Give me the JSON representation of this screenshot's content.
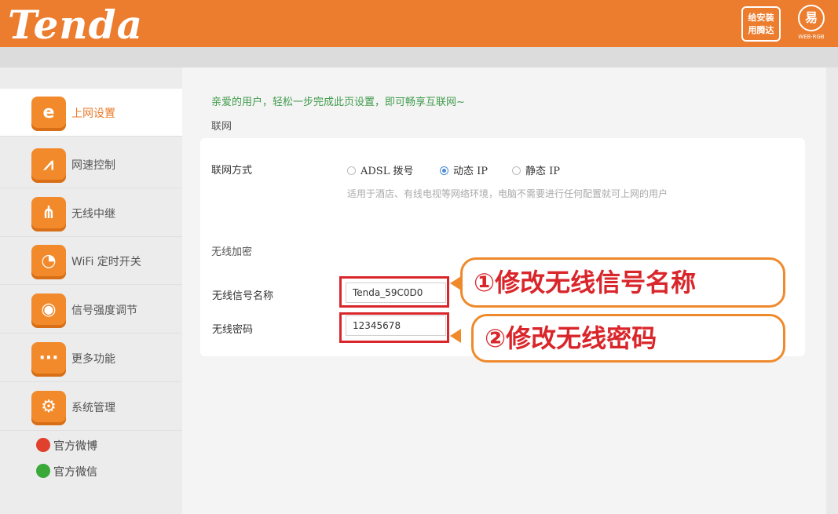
{
  "header": {
    "logo": "Tenda",
    "app_badge_line1": "给安装",
    "app_badge_line2": "用腾达",
    "brand_mark": "易",
    "brand_small": "WEB·RGB"
  },
  "sidebar": {
    "items": [
      {
        "label": "上网设置",
        "icon": "ie-icon",
        "glyph": "e"
      },
      {
        "label": "网速控制",
        "icon": "speed-icon",
        "glyph": "⩘"
      },
      {
        "label": "无线中继",
        "icon": "repeater-icon",
        "glyph": "⋔"
      },
      {
        "label": "WiFi 定时开关",
        "icon": "timer-icon",
        "glyph": "◔"
      },
      {
        "label": "信号强度调节",
        "icon": "signal-icon",
        "glyph": "◉"
      },
      {
        "label": "更多功能",
        "icon": "more-icon",
        "glyph": "···"
      },
      {
        "label": "系统管理",
        "icon": "gear-icon",
        "glyph": "⚙"
      }
    ],
    "social": [
      {
        "label": "官方微博",
        "icon": "weibo-icon"
      },
      {
        "label": "官方微信",
        "icon": "wechat-icon"
      }
    ]
  },
  "main": {
    "intro": "亲爱的用户，轻松一步完成此页设置，即可畅享互联网~",
    "internet_section": "联网",
    "connection_label": "联网方式",
    "options": [
      {
        "label": "ADSL 拨号",
        "checked": false
      },
      {
        "label": "动态 IP",
        "checked": true
      },
      {
        "label": "静态 IP",
        "checked": false
      }
    ],
    "hint": "适用于酒店、有线电视等网络环境，电脑不需要进行任何配置就可上网的用户",
    "wireless_section": "无线加密",
    "ssid_label": "无线信号名称",
    "ssid_value": "Tenda_59C0D0",
    "password_label": "无线密码",
    "password_value": "12345678"
  },
  "callouts": {
    "ssid": "①修改无线信号名称",
    "password": "②修改无线密码"
  },
  "colors": {
    "brand_orange": "#ec7c2e",
    "highlight_red": "#d9262b",
    "intro_green": "#3f9b4b"
  }
}
